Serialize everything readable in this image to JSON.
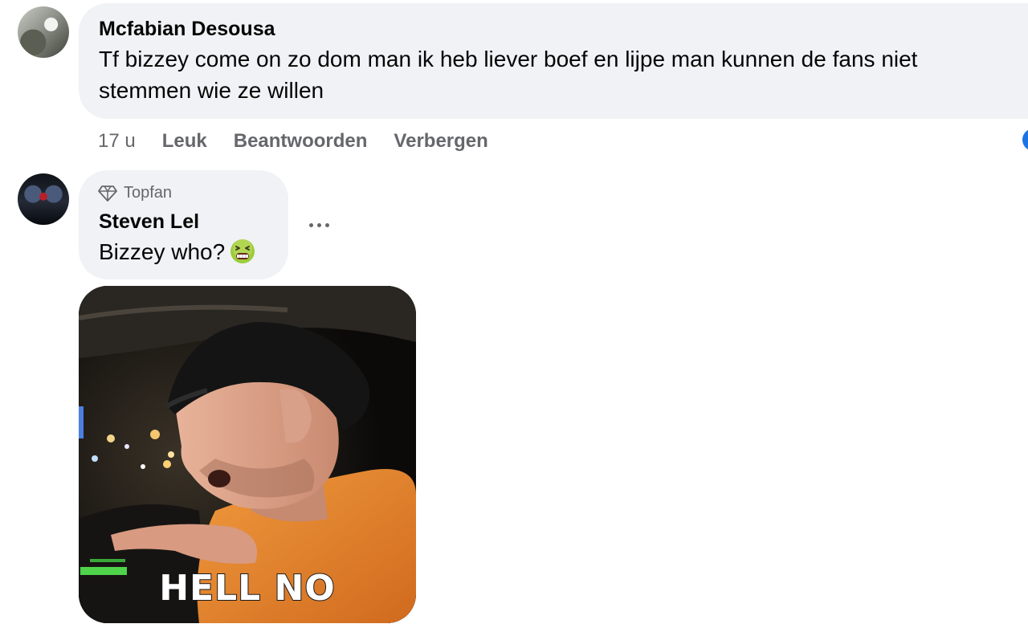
{
  "colors": {
    "bubble": "#f0f2f5",
    "meta_text": "#65676b",
    "accent": "#1b74e4",
    "gif_shirt": "#e8872d"
  },
  "comments": [
    {
      "author": "Mcfabian Desousa",
      "text": "Tf bizzey come on zo dom man ik heb liever boef en lijpe man kunnen de fans niet stemmen wie ze willen",
      "time": "17 u",
      "actions": [
        "Leuk",
        "Beantwoorden",
        "Verbergen"
      ]
    },
    {
      "badge": "Topfan",
      "badge_icon": "diamond-icon",
      "author": "Steven Lel",
      "text": "Bizzey who?",
      "emoji": "nauseated-face-emoji",
      "more_icon": "more-horizontal-icon",
      "gif": {
        "caption": "HELL NO"
      }
    }
  ]
}
